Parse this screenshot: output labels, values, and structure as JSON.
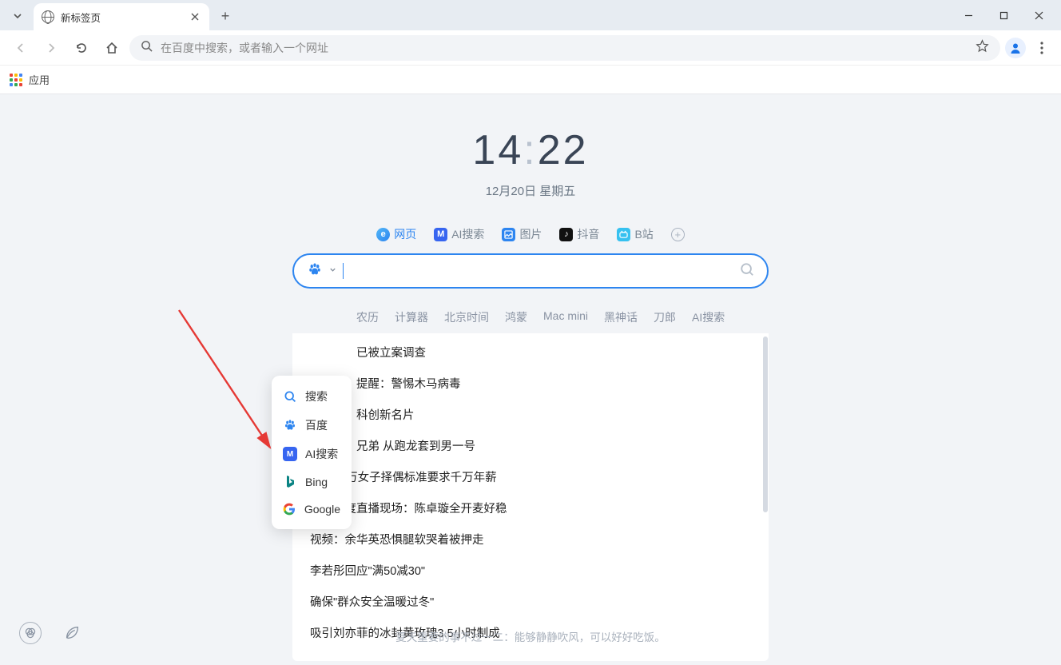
{
  "tab": {
    "title": "新标签页"
  },
  "omnibox": {
    "placeholder": "在百度中搜索，或者输入一个网址"
  },
  "bookmarks": {
    "apps_label": "应用"
  },
  "clock": {
    "hour": "14",
    "minute": "22",
    "date": "12月20日 星期五"
  },
  "search_tabs": {
    "web": "网页",
    "ai": "AI搜索",
    "img": "图片",
    "douyin": "抖音",
    "bili": "B站"
  },
  "chips": [
    "农历",
    "计算器",
    "北京时间",
    "鸿蒙",
    "Mac mini",
    "黑神话",
    "刀郎",
    "AI搜索"
  ],
  "engine_menu": [
    "搜索",
    "百度",
    "AI搜索",
    "Bing",
    "Google"
  ],
  "results_partial": [
    "已被立案调查",
    "提醒：警惕木马病毒",
    "科创新名片",
    "兄弟 从跑龙套到男一号"
  ],
  "results_full": [
    "年薪50万女子择偶标准要求千万年薪",
    "直击百度直播现场：陈卓璇全开麦好稳",
    "视频：余华英恐惧腿软哭着被押走",
    "李若彤回应\"满50减30\"",
    "确保\"群众安全温暖过冬\"",
    "吸引刘亦菲的冰封黄玫瑰3.5小时制成"
  ],
  "footer": "夏天重要的事不过一二：能够静静吹风，可以好好吃饭。"
}
